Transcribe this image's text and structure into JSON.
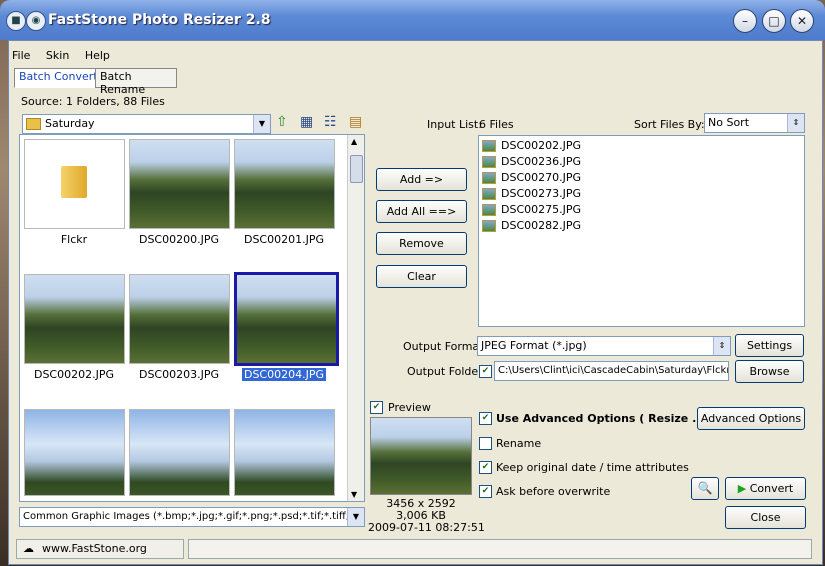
{
  "window": {
    "title": "FastStone Photo Resizer 2.8"
  },
  "menu": {
    "file": "File",
    "skin": "Skin",
    "help": "Help"
  },
  "tabs": {
    "batch_convert": "Batch Convert",
    "batch_rename": "Batch Rename"
  },
  "source": {
    "summary": "Source: 1 Folders, 88 Files",
    "folder": "Saturday",
    "filter": "Common Graphic Images (*.bmp;*.jpg;*.gif;*.png;*.psd;*.tif;*.tiff;*.pcx"
  },
  "thumbnails": [
    {
      "name": "Flckr"
    },
    {
      "name": "DSC00200.JPG"
    },
    {
      "name": "DSC00201.JPG"
    },
    {
      "name": "DSC00202.JPG"
    },
    {
      "name": "DSC00203.JPG"
    },
    {
      "name": "DSC00204.JPG"
    }
  ],
  "buttons": {
    "add": "Add =>",
    "add_all": "Add All ==>",
    "remove": "Remove",
    "clear": "Clear",
    "settings": "Settings",
    "browse": "Browse",
    "advanced": "Advanced Options",
    "convert": "Convert",
    "close": "Close"
  },
  "input_list": {
    "label": "Input List:",
    "count": "6 Files",
    "sort_label": "Sort Files By:",
    "sort_value": "No Sort",
    "files": [
      "DSC00202.JPG",
      "DSC00236.JPG",
      "DSC00270.JPG",
      "DSC00273.JPG",
      "DSC00275.JPG",
      "DSC00282.JPG"
    ]
  },
  "output": {
    "format_label": "Output Format:",
    "format_value": "JPEG Format (*.jpg)",
    "folder_label": "Output Folder:",
    "folder_value": "C:\\Users\\Clint\\ici\\CascadeCabin\\Saturday\\Flckr"
  },
  "preview": {
    "label": "Preview",
    "dimensions": "3456 x 2592",
    "size": "3,006 KB",
    "date": "2009-07-11 08:27:51"
  },
  "options": {
    "advanced": "Use Advanced Options ( Resize ... )",
    "rename": "Rename",
    "keep_date": "Keep original date / time attributes",
    "ask_overwrite": "Ask before overwrite"
  },
  "status": {
    "website": "www.FastStone.org"
  }
}
